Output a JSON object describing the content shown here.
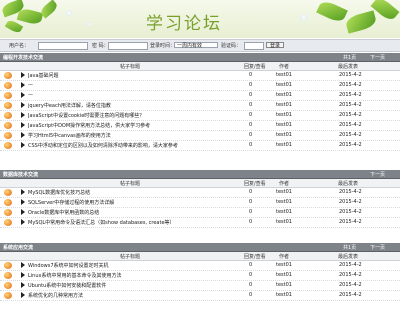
{
  "header": {
    "title": "学习论坛"
  },
  "login": {
    "username_label": "用户名：",
    "password_label": "密 码：",
    "keep_label": "登录时间：",
    "keep_value": "一周内有效",
    "captcha_label": "验证码：",
    "submit_label": "登录"
  },
  "columns": {
    "topic": "帖子标题",
    "replies": "回复/查看",
    "author": "作者",
    "last": "最后发表",
    "page_label": "共1页",
    "next_label": "下一页"
  },
  "sections": [
    {
      "name": "编程开发技术交流",
      "rows": [
        {
          "title": "Java基础问题",
          "replies": "0",
          "author": "test01",
          "last": "2015-4-2"
        },
        {
          "title": "—",
          "replies": "0",
          "author": "test01",
          "last": "2015-4-2"
        },
        {
          "title": "—",
          "replies": "0",
          "author": "test01",
          "last": "2015-4-2"
        },
        {
          "title": "jquery中each用法详解，请各位指教",
          "replies": "0",
          "author": "test01",
          "last": "2015-4-2"
        },
        {
          "title": "JavaScript中设置cookie时需要注意的问题有哪些？",
          "replies": "0",
          "author": "test01",
          "last": "2015-4-2"
        },
        {
          "title": "JavaScript中DOM操作常用方法总结，供大家学习参考",
          "replies": "0",
          "author": "test01",
          "last": "2015-4-2"
        },
        {
          "title": "学习Html5中canvas画布的使用方法",
          "replies": "0",
          "author": "test01",
          "last": "2015-4-2"
        },
        {
          "title": "CSS中浮动和定位的区别以及如何清除浮动带来的影响，请大家参考",
          "replies": "0",
          "author": "test01",
          "last": "2015-4-2"
        }
      ]
    },
    {
      "name": "数据库技术交流",
      "rows": [
        {
          "title": "MySQL数据库优化技巧总结",
          "replies": "0",
          "author": "test01",
          "last": "2015-4-2"
        },
        {
          "title": "SQLServer中存储过程的使用方法详解",
          "replies": "0",
          "author": "test01",
          "last": "2015-4-2"
        },
        {
          "title": "Oracle数据库中常用函数的总结",
          "replies": "0",
          "author": "test01",
          "last": "2015-4-2"
        },
        {
          "title": "MySQL中常用命令及语法汇总（如show databases, create等）",
          "replies": "0",
          "author": "test01",
          "last": "2015-4-2"
        }
      ]
    },
    {
      "name": "系统应用交流",
      "rows": [
        {
          "title": "Windows7系统中如何设置定时关机",
          "replies": "0",
          "author": "test01",
          "last": "2015-4-2"
        },
        {
          "title": "Linux系统中常用的基本命令及其使用方法",
          "replies": "0",
          "author": "test01",
          "last": "2015-4-2"
        },
        {
          "title": "Ubuntu系统中如何安装和配置软件",
          "replies": "0",
          "author": "test01",
          "last": "2015-4-2"
        },
        {
          "title": "系统优化的几种常用方法",
          "replies": "0",
          "author": "test01",
          "last": "2015-4-2"
        }
      ]
    }
  ]
}
